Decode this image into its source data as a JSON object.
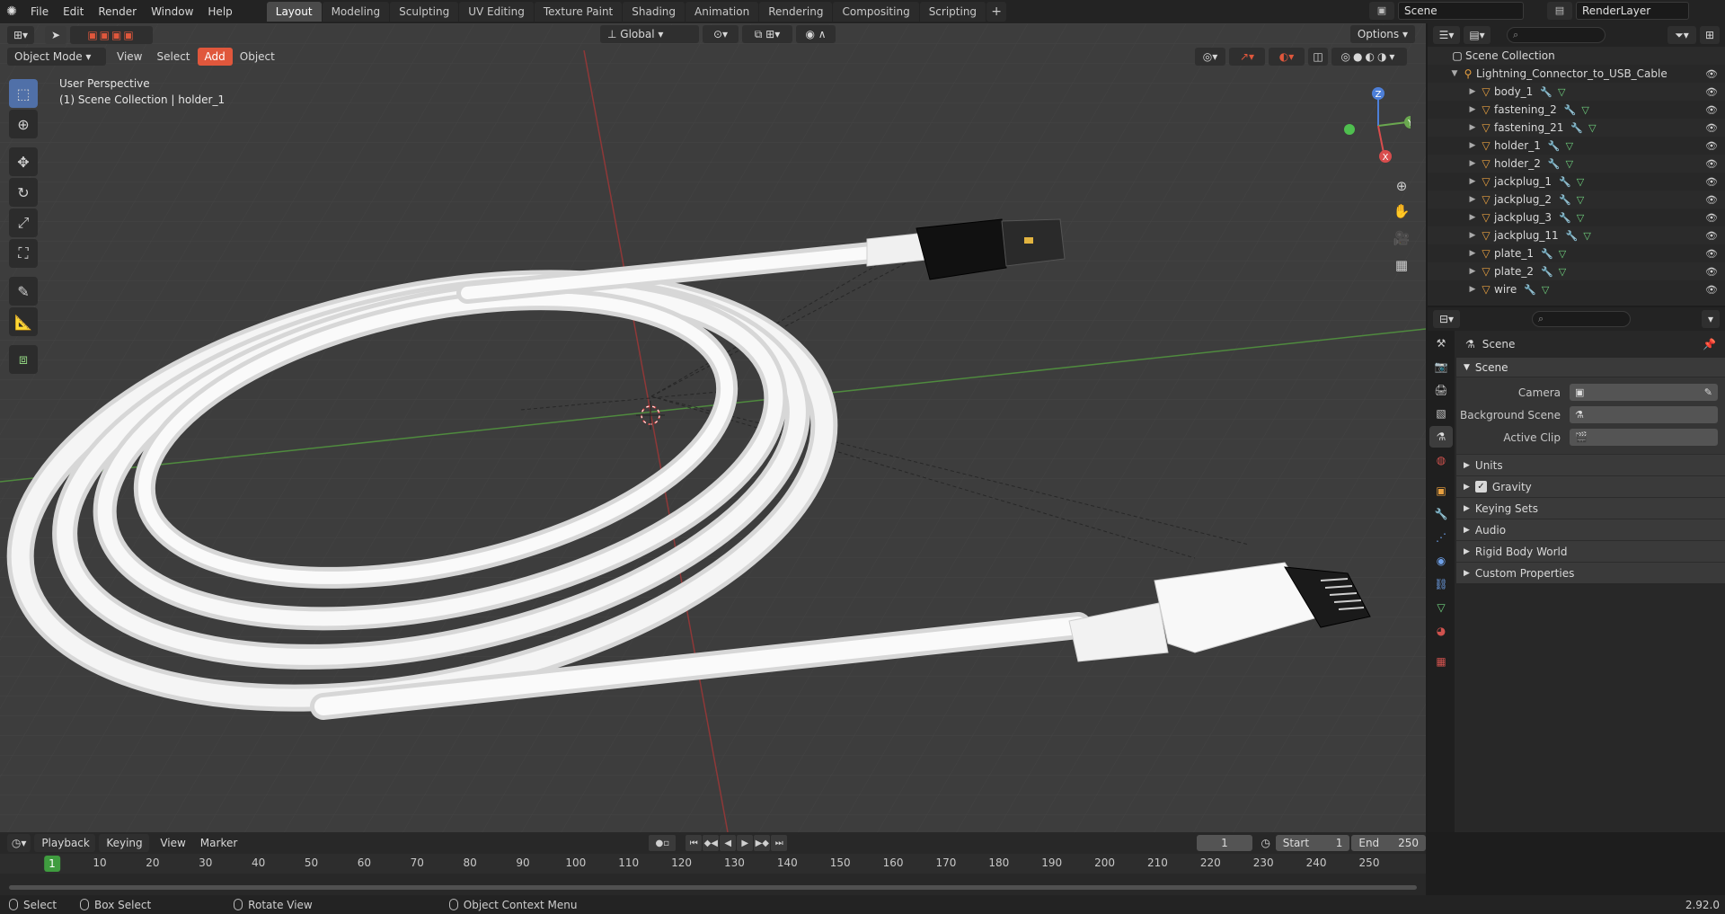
{
  "app": {
    "menus": [
      "File",
      "Edit",
      "Render",
      "Window",
      "Help"
    ],
    "workspaces": [
      "Layout",
      "Modeling",
      "Sculpting",
      "UV Editing",
      "Texture Paint",
      "Shading",
      "Animation",
      "Rendering",
      "Compositing",
      "Scripting"
    ],
    "active_workspace": "Layout",
    "add_tab": "+",
    "scene_name": "Scene",
    "view_layer": "RenderLayer"
  },
  "viewport": {
    "mode": "Object Mode",
    "menus": [
      "View",
      "Select",
      "Add",
      "Object"
    ],
    "orientation": "Global",
    "options_label": "Options",
    "perspective_label": "User Perspective",
    "collection_label": "(1) Scene Collection | holder_1",
    "gizmo_axes": {
      "x": "X",
      "y": "Y",
      "z": "Z"
    }
  },
  "outliner": {
    "root": "Scene Collection",
    "collection": "Lightning_Connector_to_USB_Cable",
    "objects": [
      "body_1",
      "fastening_2",
      "fastening_21",
      "holder_1",
      "holder_2",
      "jackplug_1",
      "jackplug_2",
      "jackplug_3",
      "jackplug_11",
      "plate_1",
      "plate_2",
      "wire"
    ]
  },
  "properties": {
    "context": "Scene",
    "panel_title": "Scene",
    "fields": [
      {
        "label": "Camera",
        "value": ""
      },
      {
        "label": "Background Scene",
        "value": ""
      },
      {
        "label": "Active Clip",
        "value": ""
      }
    ],
    "sub_panels": [
      "Units",
      "Gravity",
      "Keying Sets",
      "Audio",
      "Rigid Body World",
      "Custom Properties"
    ],
    "gravity_checked": true
  },
  "timeline": {
    "menus": [
      "Playback",
      "Keying",
      "View",
      "Marker"
    ],
    "current_frame": "1",
    "start_label": "Start",
    "start": "1",
    "end_label": "End",
    "end": "250",
    "ruler": [
      "1",
      "10",
      "20",
      "30",
      "40",
      "50",
      "60",
      "70",
      "80",
      "90",
      "100",
      "110",
      "120",
      "130",
      "140",
      "150",
      "160",
      "170",
      "180",
      "190",
      "200",
      "210",
      "220",
      "230",
      "240",
      "250"
    ]
  },
  "statusbar": {
    "select": "Select",
    "box_select": "Box Select",
    "rotate_view": "Rotate View",
    "context_menu": "Object Context Menu",
    "version": "2.92.0"
  },
  "colors": {
    "active_tab": "#4a4a4a",
    "add_menu": "#e0573c",
    "current_frame": "#3f9c3f",
    "object_icon": "#e8a040"
  }
}
